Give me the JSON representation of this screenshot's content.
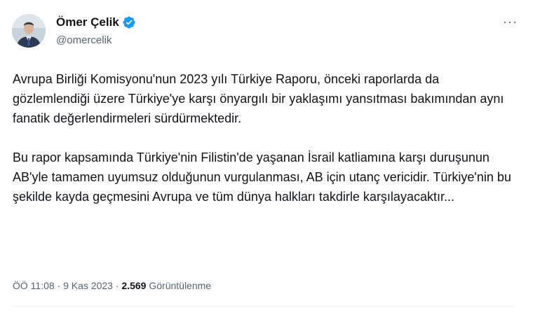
{
  "author": {
    "name": "Ömer Çelik",
    "handle": "@omercelik",
    "verified": true,
    "verified_color": "#1d9bf0"
  },
  "menu": {
    "more_label": "···"
  },
  "tweet": {
    "paragraphs": [
      "Avrupa Birliği Komisyonu'nun 2023 yılı Türkiye Raporu, önceki raporlarda da gözlemlendiği üzere Türkiye'ye karşı önyargılı bir yaklaşımı yansıtması bakımından aynı fanatik değerlendirmeleri sürdürmektedir.",
      "Bu rapor kapsamında Türkiye'nin Filistin'de yaşanan İsrail katliamına karşı duruşunun AB'yle tamamen uyumsuz olduğunun vurgulanması, AB için utanç vericidir. Türkiye'nin bu şekilde kayda geçmesini Avrupa ve tüm dünya halkları takdirle karşılayacaktır..."
    ]
  },
  "meta": {
    "time": "ÖÖ 11:08",
    "separator": "·",
    "date": "9 Kas 2023",
    "views_count": "2.569",
    "views_label": "Görüntülenme"
  },
  "icons": {
    "avatar": "avatar-photo",
    "verified": "verified-badge-icon",
    "more": "more-icon"
  }
}
